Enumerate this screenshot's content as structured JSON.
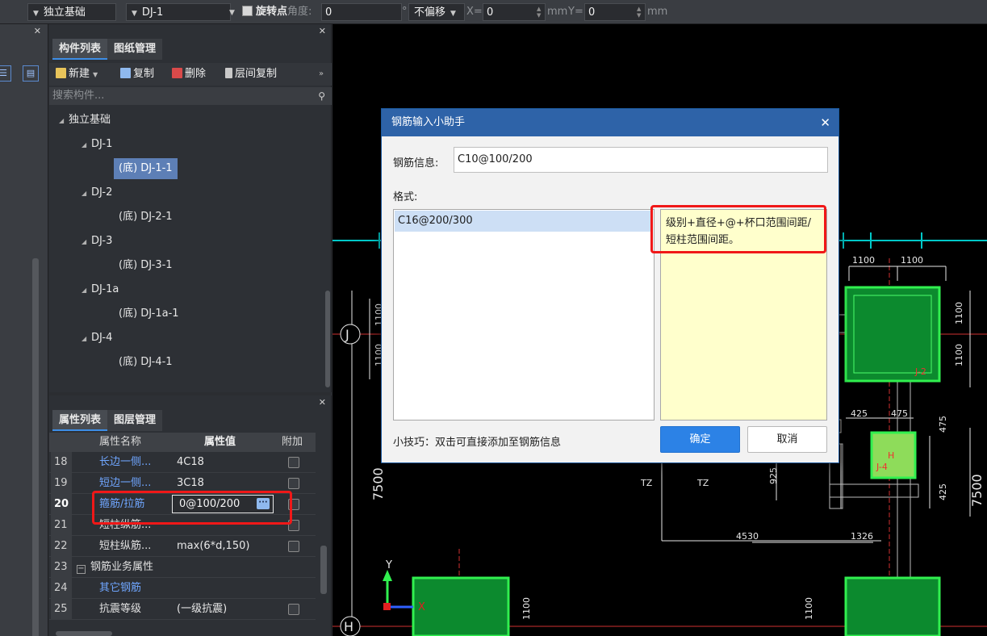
{
  "toolbar": {
    "type_combo": "独立基础",
    "name_combo": "DJ-1",
    "rotate_label": "旋转点",
    "angle_label": "角度:",
    "angle_value": "0",
    "degree_unit": "°",
    "offset_combo": "不偏移",
    "x_label": "X=",
    "x_value": "0",
    "x_unit": "mm",
    "y_label": "Y=",
    "y_value": "0",
    "y_unit": "mm"
  },
  "component_panel": {
    "tabs": [
      "构件列表",
      "图纸管理"
    ],
    "actions": {
      "new": "新建",
      "copy": "复制",
      "delete": "删除",
      "floor_copy": "层间复制"
    },
    "search_placeholder": "搜索构件...",
    "tree": {
      "root": "独立基础",
      "groups": [
        {
          "name": "DJ-1",
          "child": "(底) DJ-1-1"
        },
        {
          "name": "DJ-2",
          "child": "(底) DJ-2-1"
        },
        {
          "name": "DJ-3",
          "child": "(底) DJ-3-1"
        },
        {
          "name": "DJ-1a",
          "child": "(底) DJ-1a-1"
        },
        {
          "name": "DJ-4",
          "child": "(底) DJ-4-1"
        }
      ]
    }
  },
  "property_panel": {
    "tabs": [
      "属性列表",
      "图层管理"
    ],
    "headers": {
      "name": "属性名称",
      "value": "属性值",
      "extra": "附加"
    },
    "rows": [
      {
        "num": "18",
        "name": "长边一侧...",
        "value": "4C18"
      },
      {
        "num": "19",
        "name": "短边一侧...",
        "value": "3C18"
      },
      {
        "num": "20",
        "name": "箍筋/拉筋",
        "value": "0@100/200"
      },
      {
        "num": "21",
        "name": "短柱纵筋...",
        "value": ""
      },
      {
        "num": "22",
        "name": "短柱纵筋...",
        "value": "max(6*d,150)"
      },
      {
        "num": "23",
        "name": "钢筋业务属性",
        "value": ""
      },
      {
        "num": "24",
        "name": "其它钢筋",
        "value": ""
      },
      {
        "num": "25",
        "name": "抗震等级",
        "value": "(一级抗震)"
      }
    ]
  },
  "dialog": {
    "title": "钢筋输入小助手",
    "info_label": "钢筋信息:",
    "info_value": "C10@100/200",
    "format_label": "格式:",
    "format_item": "C16@200/300",
    "format_desc": "级别+直径+@+杯口范围间距/短柱范围间距。",
    "tip": "小技巧：双击可直接添加至钢筋信息",
    "ok": "确定",
    "cancel": "取消"
  },
  "drawing": {
    "axis_labels": [
      "J",
      "H"
    ],
    "dims": [
      "1100",
      "1100",
      "1100",
      "1100",
      "1100",
      "1100",
      "425",
      "475",
      "475",
      "425",
      "925",
      "4530",
      "1326",
      "7500",
      "7500",
      "1100",
      "1100"
    ],
    "tags": [
      "TZ",
      "TZ",
      "J-2",
      "J-4",
      "H"
    ],
    "coord_x": "X",
    "coord_y": "Y"
  },
  "colors": {
    "accent": "#2e63a8",
    "ok_button": "#2c82e6",
    "highlight_red": "#f01818",
    "footing_green": "#0c8a2e",
    "cad_cyan": "#00c8c8"
  }
}
